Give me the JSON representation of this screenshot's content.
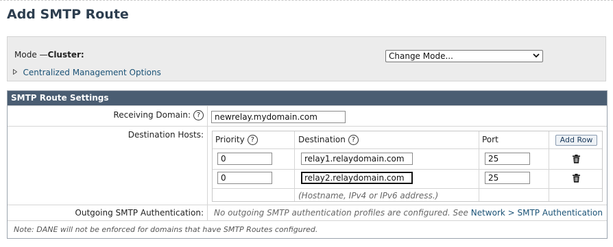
{
  "header": {
    "title": "Add SMTP Route"
  },
  "mode": {
    "label": "Mode —",
    "value": "Cluster:",
    "select_value": "Change Mode...",
    "centralized_link": "Centralized Management Options"
  },
  "settings": {
    "title": "SMTP Route Settings",
    "receiving_domain": {
      "label": "Receiving Domain:",
      "value": "newrelay.mydomain.com"
    },
    "destination_hosts": {
      "label": "Destination Hosts:",
      "columns": {
        "priority": "Priority",
        "destination": "Destination",
        "port": "Port"
      },
      "add_row_label": "Add Row",
      "rows": [
        {
          "priority": "0",
          "destination": "relay1.relaydomain.com",
          "port": "25"
        },
        {
          "priority": "0",
          "destination": "relay2.relaydomain.com",
          "port": "25"
        }
      ],
      "hint": "(Hostname, IPv4 or IPv6 address.)"
    },
    "auth": {
      "label": "Outgoing SMTP Authentication:",
      "text": "No outgoing SMTP authentication profiles are configured. See ",
      "link": "Network > SMTP Authentication"
    },
    "note": "Note: DANE will not be enforced for domains that have SMTP Routes configured."
  },
  "icons": {
    "help": "help-circle-icon",
    "trash": "trash-icon",
    "expand": "triangle-right-icon",
    "dropdown": "chevron-down-icon"
  },
  "colors": {
    "section_header": "#4a5d72",
    "title": "#2d3e4f",
    "link": "#1a5276"
  }
}
